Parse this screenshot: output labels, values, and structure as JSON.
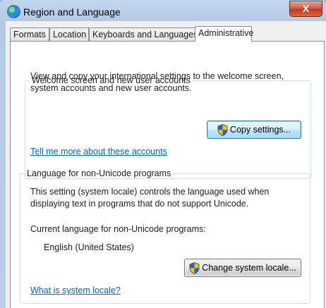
{
  "window": {
    "title": "Region and Language",
    "close_glyph": "X"
  },
  "tabs": [
    {
      "label": "Formats"
    },
    {
      "label": "Location"
    },
    {
      "label": "Keyboards and Languages"
    },
    {
      "label": "Administrative",
      "active": true
    }
  ],
  "welcome_group": {
    "legend": "Welcome screen and new user accounts",
    "description_line1": "View and copy your international settings to the welcome screen,",
    "description_line2": "system accounts and new user accounts.",
    "copy_button": "Copy settings...",
    "link": "Tell me more about these accounts"
  },
  "nonunicode_group": {
    "legend": "Language for non-Unicode programs",
    "description_line1": "This setting (system locale) controls the language used when",
    "description_line2": "displaying text in programs that do not support Unicode.",
    "current_label": "Current language for non-Unicode programs:",
    "current_value": "English (United States)",
    "change_button": "Change system locale...",
    "link": "What is system locale?"
  },
  "icons": {
    "app": "globe-icon",
    "shield": "uac-shield-icon"
  }
}
